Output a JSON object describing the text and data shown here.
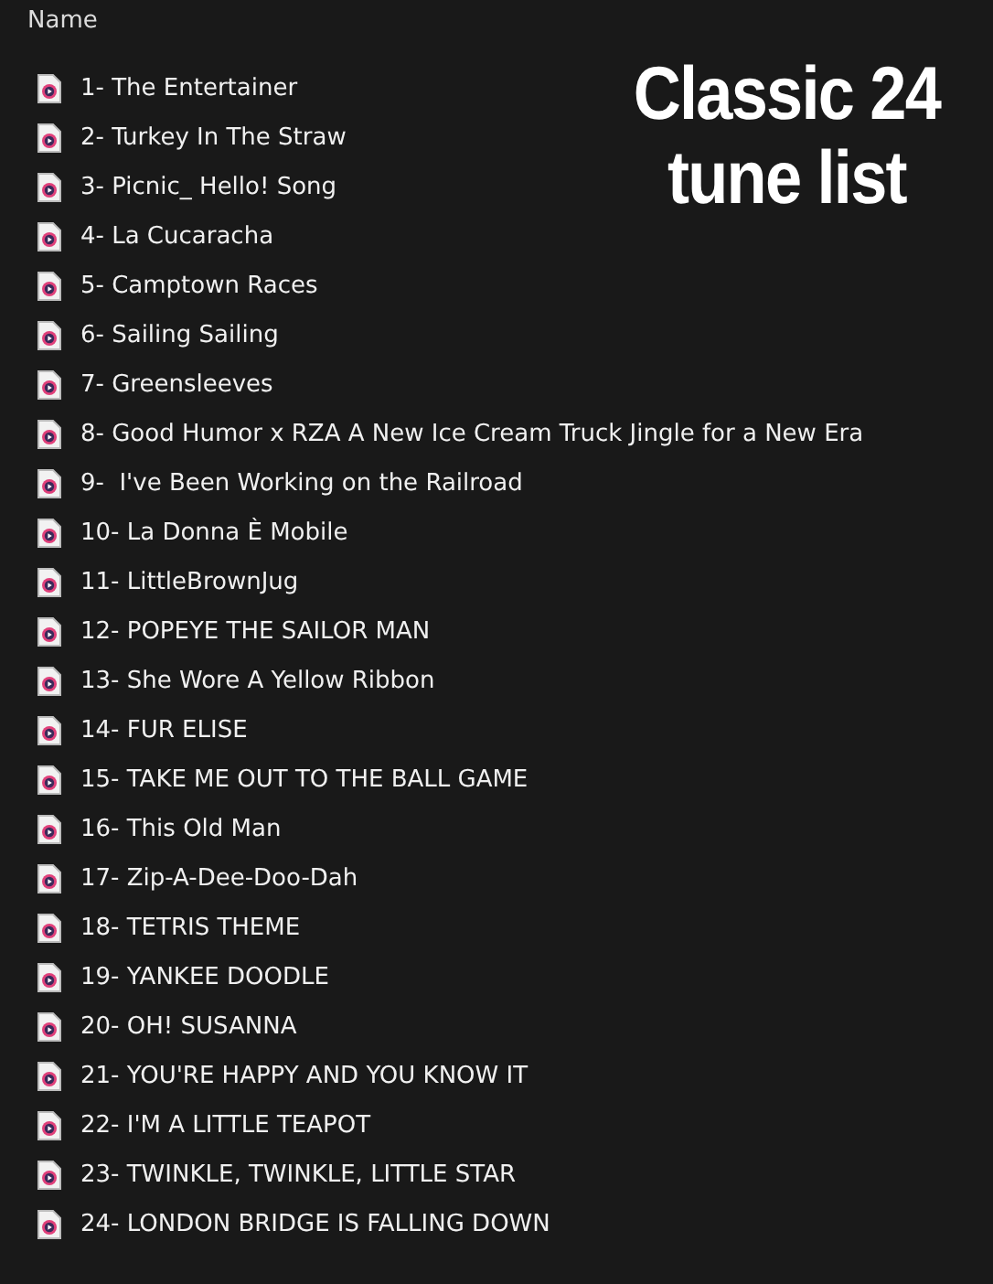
{
  "header": {
    "column": "Name"
  },
  "title": "Classic 24 tune list",
  "files": [
    {
      "name": "1- The Entertainer"
    },
    {
      "name": "2- Turkey In The Straw"
    },
    {
      "name": "3- Picnic_ Hello! Song"
    },
    {
      "name": "4- La Cucaracha"
    },
    {
      "name": "5- Camptown Races"
    },
    {
      "name": "6- Sailing Sailing"
    },
    {
      "name": "7- Greensleeves"
    },
    {
      "name": "8- Good Humor x RZA A New Ice Cream Truck Jingle for a New Era"
    },
    {
      "name": "9-  I've Been Working on the Railroad"
    },
    {
      "name": "10- La Donna È Mobile"
    },
    {
      "name": "11- LittleBrownJug"
    },
    {
      "name": "12- POPEYE THE SAILOR MAN"
    },
    {
      "name": "13- She Wore A Yellow Ribbon"
    },
    {
      "name": "14- FUR ELISE"
    },
    {
      "name": "15- TAKE ME OUT TO THE BALL GAME"
    },
    {
      "name": "16- This Old Man"
    },
    {
      "name": "17- Zip-A-Dee-Doo-Dah"
    },
    {
      "name": "18- TETRIS THEME"
    },
    {
      "name": "19- YANKEE DOODLE"
    },
    {
      "name": "20- OH! SUSANNA"
    },
    {
      "name": "21- YOU'RE HAPPY AND YOU KNOW IT"
    },
    {
      "name": "22- I'M A LITTLE TEAPOT"
    },
    {
      "name": "23- TWINKLE, TWINKLE, LITTLE STAR"
    },
    {
      "name": "24- LONDON BRIDGE IS FALLING DOWN"
    }
  ]
}
